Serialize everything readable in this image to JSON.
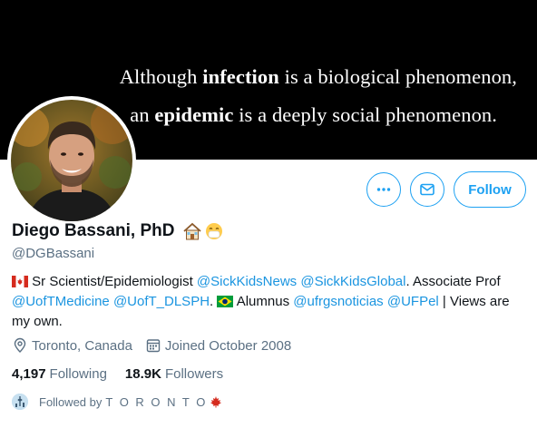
{
  "banner": {
    "line1_pre": "Although ",
    "line1_bold": "infection",
    "line1_post": " is a biological phenomenon,",
    "line2_pre": "an ",
    "line2_bold": "epidemic",
    "line2_post": " is a deeply social phenomenon."
  },
  "profile": {
    "name": "Diego Bassani, PhD",
    "handle": "@DGBassani",
    "name_emojis": [
      "house-icon",
      "mask-face-icon"
    ]
  },
  "actions": {
    "more_icon": "more-icon",
    "message_icon": "envelope-icon",
    "follow_label": "Follow"
  },
  "bio": {
    "p1": " Sr Scientist/Epidemiologist ",
    "link1": "@SickKidsNews",
    "p2": " ",
    "link2": "@SickKidsGlobal",
    "p3": ". Associate Prof ",
    "link3": "@UofTMedicine",
    "p4": " ",
    "link4": "@UofT_DLSPH",
    "p5": ". ",
    "p6": " Alumnus ",
    "link5": "@ufrgsnoticias",
    "p7": " ",
    "link6": "@UFPel",
    "p8": " | Views are my own."
  },
  "meta": {
    "location": "Toronto, Canada",
    "joined": "Joined October 2008"
  },
  "stats": {
    "following_count": "4,197",
    "following_label": "Following",
    "followers_count": "18.9K",
    "followers_label": "Followers"
  },
  "followed_by": {
    "prefix": "Followed by",
    "name": "T O R O N T O"
  },
  "colors": {
    "accent": "#1da1f2",
    "link": "#1b95e0",
    "secondary_text": "#5b7083",
    "banner_bg": "#000000"
  }
}
